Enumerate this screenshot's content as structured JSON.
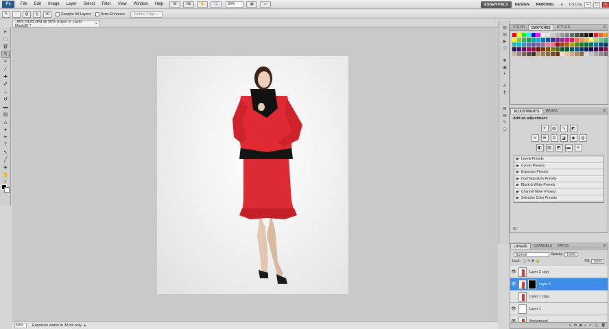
{
  "menubar": {
    "logo": "Ps",
    "items": [
      "File",
      "Edit",
      "Image",
      "Layer",
      "Select",
      "Filter",
      "View",
      "Window",
      "Help"
    ],
    "zoom": "50%",
    "workspaces": [
      "ESSENTIALS",
      "DESIGN",
      "PAINTING"
    ],
    "more": "»",
    "cs_live": "CS Live"
  },
  "options": {
    "brush_size": "30",
    "sample_all_layers": "Sample All Layers",
    "auto_enhance": "Auto-Enhance",
    "refine_edge": "Refine Edge..."
  },
  "document": {
    "tab_title": "_MG_0128.JPG @ 50% (Layer 2, Layer Mask/8) *",
    "close": "×"
  },
  "status": {
    "zoom": "50%",
    "info": "Exposure works in 32-bit only",
    "arrow": "▸"
  },
  "swatches_panel": {
    "tabs": [
      "COLOR",
      "SWATCHES",
      "STYLES"
    ],
    "active_tab": "SWATCHES",
    "colors": [
      "#ff0000",
      "#ffff00",
      "#00ff00",
      "#00ffff",
      "#0000ff",
      "#ff00ff",
      "#ffffff",
      "#e6e6e6",
      "#cccccc",
      "#b3b3b3",
      "#999999",
      "#808080",
      "#666666",
      "#4d4d4d",
      "#333333",
      "#1a1a1a",
      "#000000",
      "#ed1c24",
      "#f26522",
      "#f7941d",
      "#fff200",
      "#8dc63f",
      "#39b54a",
      "#00a651",
      "#00a99d",
      "#00aeef",
      "#0072bc",
      "#0054a6",
      "#2e3192",
      "#662d91",
      "#92278f",
      "#ec008c",
      "#ed145b",
      "#f26c4f",
      "#f68e55",
      "#fbaf5c",
      "#fff467",
      "#acd372",
      "#7cc576",
      "#3bb878",
      "#1abbb4",
      "#00bff3",
      "#438ccb",
      "#5574b9",
      "#605ca8",
      "#855fa8",
      "#a763a8",
      "#f06eaa",
      "#f26d7d",
      "#9e0b0f",
      "#a0410d",
      "#a36209",
      "#aba000",
      "#598527",
      "#197b30",
      "#007236",
      "#00746b",
      "#0076a3",
      "#004b80",
      "#003471",
      "#1b1464",
      "#440e62",
      "#630460",
      "#9e005d",
      "#9e0039",
      "#790000",
      "#7b2e00",
      "#7d4900",
      "#827b00",
      "#406618",
      "#005e20",
      "#005826",
      "#005952",
      "#005b7f",
      "#003663",
      "#002157",
      "#0d004c",
      "#32004b",
      "#4b0049",
      "#7b0046",
      "#c7b299",
      "#998675",
      "#736357",
      "#534741",
      "#37302a",
      "#c69c6d",
      "#a67c52",
      "#8c6239",
      "#754c24",
      "#603913",
      "#f4e3c9",
      "#e0c7a0",
      "#cfa97a",
      "#b48b58",
      "#8a6a3f",
      "#d9d9d9",
      "#bfbfbf",
      "#a6a6a6",
      "#8c8c8c",
      "#737373"
    ]
  },
  "adjustments_panel": {
    "tabs": [
      "ADJUSTMENTS",
      "MASKS"
    ],
    "active_tab": "ADJUSTMENTS",
    "title": "Add an adjustment",
    "presets": [
      "Levels Presets",
      "Curves Presets",
      "Exposure Presets",
      "Hue/Saturation Presets",
      "Black & White Presets",
      "Channel Mixer Presets",
      "Selective Color Presets"
    ]
  },
  "layers_panel": {
    "tabs": [
      "LAYERS",
      "CHANNELS",
      "PATHS"
    ],
    "active_tab": "LAYERS",
    "blend_mode": "Normal",
    "opacity_label": "Opacity:",
    "opacity_value": "100%",
    "lock_label": "Lock:",
    "fill_label": "Fill:",
    "fill_value": "100%",
    "layers": [
      {
        "name": "Layer 2 copy",
        "visible": true,
        "selected": false,
        "mask": false
      },
      {
        "name": "Layer 2",
        "visible": true,
        "selected": true,
        "mask": true
      },
      {
        "name": "Layer 1 copy",
        "visible": false,
        "selected": false,
        "mask": false
      },
      {
        "name": "Layer 1",
        "visible": true,
        "selected": false,
        "mask": false
      },
      {
        "name": "Background",
        "visible": true,
        "selected": false,
        "mask": false
      }
    ]
  },
  "colors": {
    "selection_blue": "#3d8ee6",
    "dress_red": "#d8232a"
  }
}
